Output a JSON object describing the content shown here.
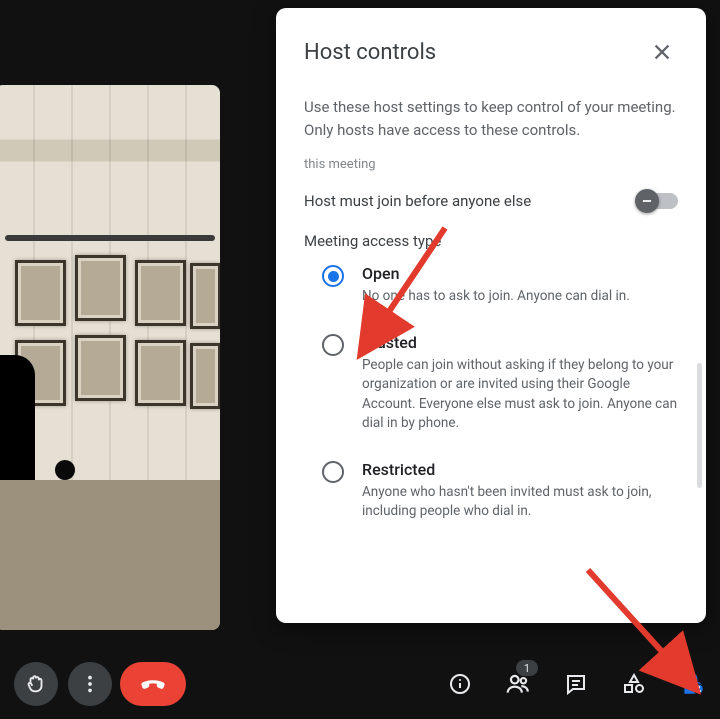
{
  "panel": {
    "title": "Host controls",
    "description": "Use these host settings to keep control of your meeting. Only hosts have access to these controls.",
    "scope_label": "this meeting",
    "toggle": {
      "label": "Host must join before anyone else",
      "state": "off"
    },
    "access_label": "Meeting access type",
    "options": [
      {
        "key": "open",
        "title": "Open",
        "desc": "No one has to ask to join. Anyone can dial in.",
        "selected": true
      },
      {
        "key": "trusted",
        "title": "Trusted",
        "desc": "People can join without asking if they belong to your organization or are invited using their Google Account. Everyone else must ask to join. Anyone can dial in by phone.",
        "selected": false
      },
      {
        "key": "restricted",
        "title": "Restricted",
        "desc": "Anyone who hasn't been invited must ask to join, including people who dial in.",
        "selected": false
      }
    ]
  },
  "toolbar": {
    "participants_badge": "1"
  },
  "colors": {
    "blue": "#1a73e8",
    "red": "#ea4335"
  }
}
